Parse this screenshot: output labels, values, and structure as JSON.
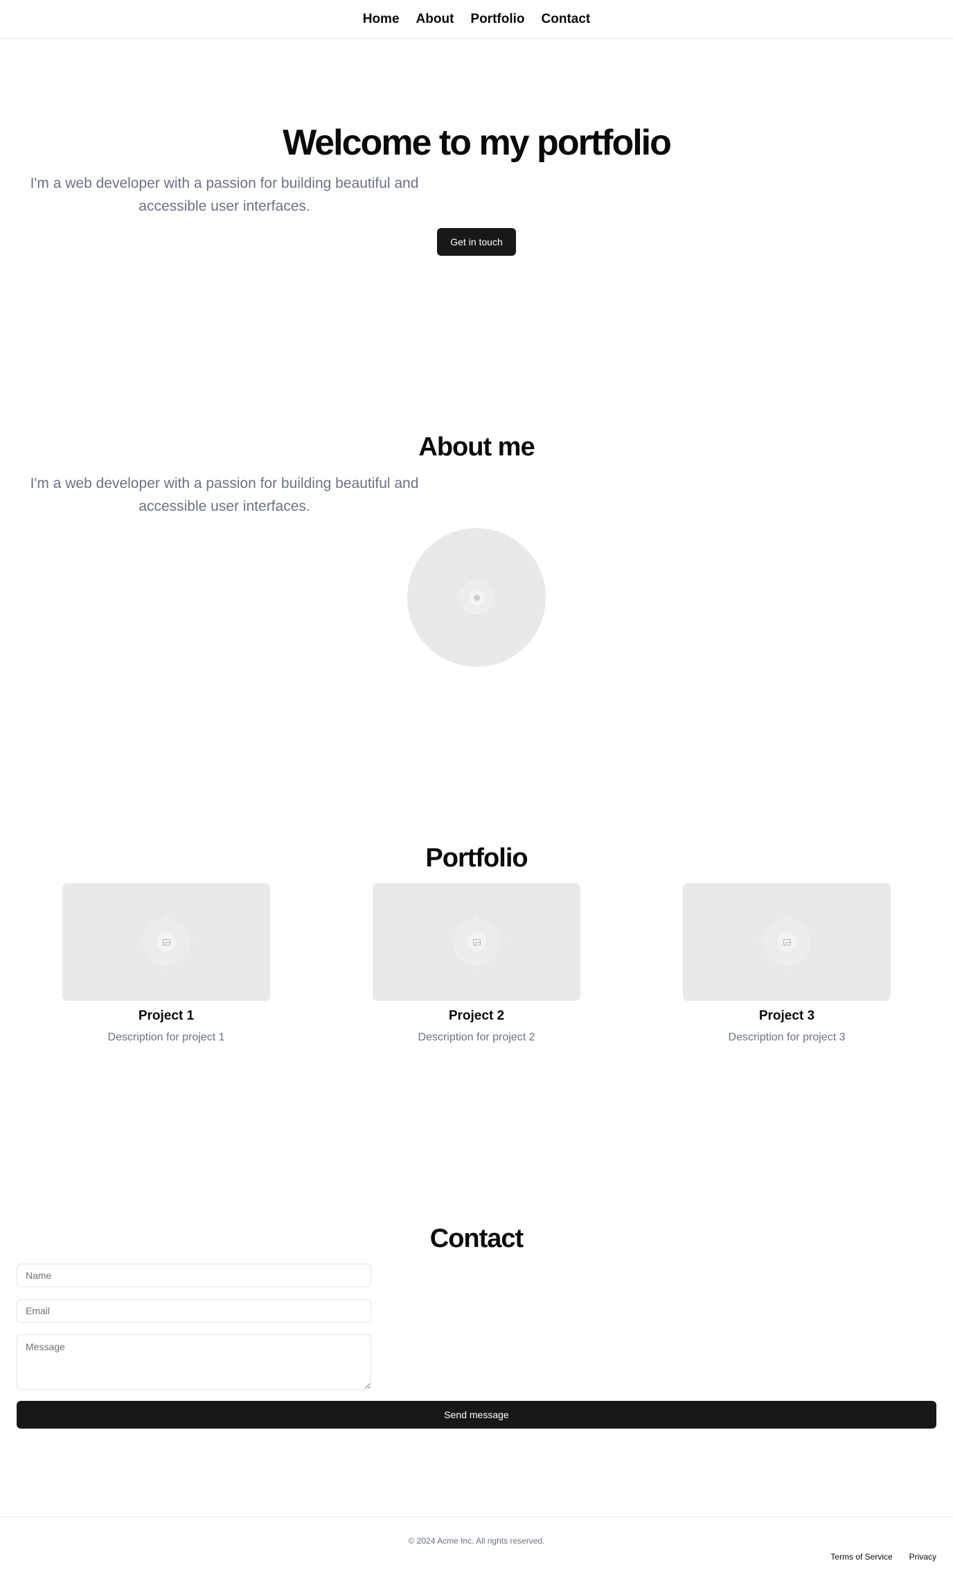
{
  "nav": {
    "items": [
      {
        "label": "Home"
      },
      {
        "label": "About"
      },
      {
        "label": "Portfolio"
      },
      {
        "label": "Contact"
      }
    ]
  },
  "hero": {
    "title": "Welcome to my portfolio",
    "subtitle": "I'm a web developer with a passion for building beautiful and accessible user interfaces.",
    "cta_label": "Get in touch"
  },
  "about": {
    "title": "About me",
    "text": "I'm a web developer with a passion for building beautiful and accessible user interfaces."
  },
  "portfolio": {
    "title": "Portfolio",
    "projects": [
      {
        "name": "Project 1",
        "description": "Description for project 1"
      },
      {
        "name": "Project 2",
        "description": "Description for project 2"
      },
      {
        "name": "Project 3",
        "description": "Description for project 3"
      }
    ]
  },
  "contact": {
    "title": "Contact",
    "name_placeholder": "Name",
    "email_placeholder": "Email",
    "message_placeholder": "Message",
    "send_label": "Send message"
  },
  "footer": {
    "copyright": "© 2024 Acme Inc. All rights reserved.",
    "links": [
      {
        "label": "Terms of Service"
      },
      {
        "label": "Privacy"
      }
    ]
  },
  "colors": {
    "button_bg": "#18181b",
    "muted_text": "#6b7280",
    "placeholder_bg": "#e9e9e9",
    "border": "#e5e7eb"
  },
  "icons": {
    "avatar_placeholder": "placeholder-icon",
    "project_placeholder": "image-icon"
  }
}
